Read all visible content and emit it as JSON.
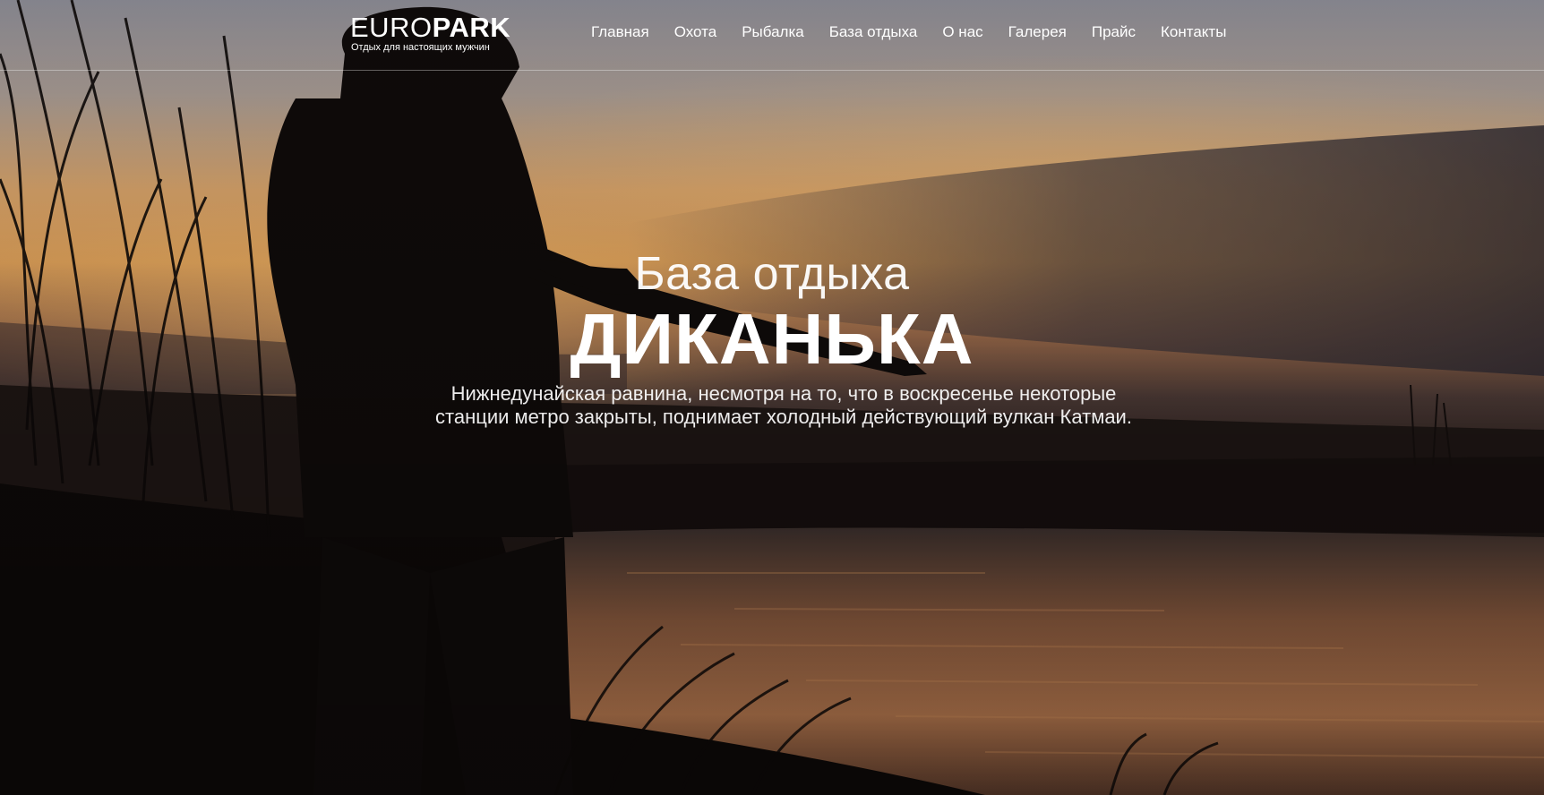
{
  "header": {
    "logo": {
      "word_light": "EURO",
      "word_bold": "PARK",
      "tagline": "Отдых для настоящих мужчин"
    },
    "nav": [
      {
        "label": "Главная"
      },
      {
        "label": "Охота"
      },
      {
        "label": "Рыбалка"
      },
      {
        "label": "База отдыха"
      },
      {
        "label": "О нас"
      },
      {
        "label": "Галерея"
      },
      {
        "label": "Прайс"
      },
      {
        "label": "Контакты"
      }
    ]
  },
  "hero": {
    "subtitle": "База отдыха",
    "title": "ДИКАНЬКА",
    "description": "Нижнедунайская равнина, несмотря на то, что в воскресенье некоторые станции метро закрыты, поднимает холодный действующий вулкан Катмаи."
  },
  "colors": {
    "text": "#ffffff",
    "sky_top": "#7d7a80",
    "sky_glow": "#e9a65a",
    "water": "#3a2c2a"
  }
}
